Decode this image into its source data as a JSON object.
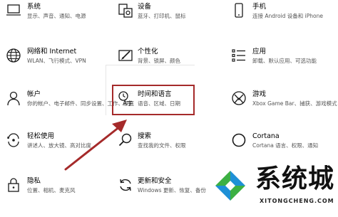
{
  "settings": {
    "tiles": [
      {
        "id": "system",
        "title": "系统",
        "desc": "显示、声音、通知、电源",
        "icon": "laptop-icon"
      },
      {
        "id": "devices",
        "title": "设备",
        "desc": "蓝牙、打印机、鼠标",
        "icon": "keyboard-speaker-icon"
      },
      {
        "id": "phone",
        "title": "手机",
        "desc": "连接 Android 设备和 iPhone",
        "icon": "phone-icon"
      },
      {
        "id": "network",
        "title": "网络和 Internet",
        "desc": "WLAN、飞行模式、VPN",
        "icon": "globe-icon"
      },
      {
        "id": "personalization",
        "title": "个性化",
        "desc": "背景、锁屏、颜色",
        "icon": "paint-brush-icon"
      },
      {
        "id": "apps",
        "title": "应用",
        "desc": "卸载、默认应用、可选功能",
        "icon": "app-list-icon"
      },
      {
        "id": "accounts",
        "title": "帐户",
        "desc": "你的帐户、电子邮件、同步设置、工作、家庭",
        "icon": "person-icon"
      },
      {
        "id": "time-language",
        "title": "时间和语言",
        "desc": "语音、区域、日期",
        "icon": "time-language-icon"
      },
      {
        "id": "gaming",
        "title": "游戏",
        "desc": "Xbox Game Bar、捕获、游戏模式",
        "icon": "xbox-icon"
      },
      {
        "id": "ease-of-access",
        "title": "轻松使用",
        "desc": "讲述人、放大镜、高对比度",
        "icon": "ease-of-access-icon"
      },
      {
        "id": "search",
        "title": "搜索",
        "desc": "查找我的文件、权限",
        "icon": "search-icon"
      },
      {
        "id": "cortana",
        "title": "Cortana",
        "desc": "Cortana 语言、权限、通知",
        "icon": "cortana-icon"
      },
      {
        "id": "privacy",
        "title": "隐私",
        "desc": "位置、相机、麦克风",
        "icon": "lock-icon"
      },
      {
        "id": "update",
        "title": "更新和安全",
        "desc": "Windows 更新、恢复、备份",
        "icon": "sync-icon"
      }
    ]
  },
  "watermark": {
    "brand": "系统城",
    "domain": "XITONGCHENG.COM"
  },
  "colors": {
    "highlight": "#a52a2a",
    "icon": "#1a1a1a",
    "text": "#000000",
    "desc": "#555555",
    "logo_blue": "#1e90d6",
    "logo_green": "#3cb043"
  }
}
